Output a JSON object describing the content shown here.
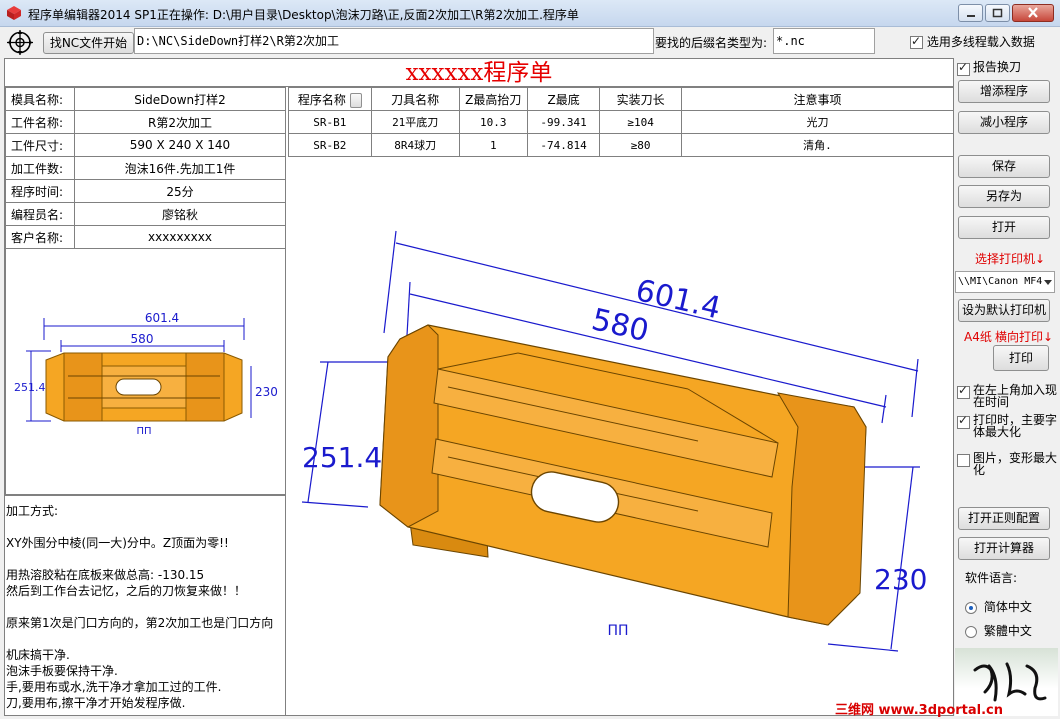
{
  "window": {
    "title": "程序单编辑器2014 SP1正在操作: D:\\用户目录\\Desktop\\泡沫刀路\\正,反面2次加工\\R第2次加工.程序单"
  },
  "toolbar": {
    "find_button": "找NC文件开始",
    "path_value": "D:\\NC\\SideDown打样2\\R第2次加工",
    "ext_label": "要找的后缀名类型为:",
    "ext_value": "*.nc",
    "multiline_label": "选用多线程载入数据",
    "multiline_checked": true
  },
  "sheet": {
    "title": "xxxxxx程序单",
    "info": [
      {
        "key": "模具名称:",
        "value": "SideDown打样2"
      },
      {
        "key": "工件名称:",
        "value": "R第2次加工"
      },
      {
        "key": "工件尺寸:",
        "value": "590 X 240 X 140"
      },
      {
        "key": "加工件数:",
        "value": "泡沫16件.先加工1件"
      },
      {
        "key": "程序时间:",
        "value": "25分"
      },
      {
        "key": "编程员名:",
        "value": "廖铭秋"
      },
      {
        "key": "客户名称:",
        "value": "xxxxxxxxx"
      }
    ],
    "program_headers": [
      "程序名称",
      "刀具名称",
      "Z最高抬刀",
      "Z最底",
      "实装刀长",
      "注意事项"
    ],
    "program_rows": [
      [
        "SR-B1",
        "21平底刀",
        "10.3",
        "-99.341",
        "≥104",
        "光刀"
      ],
      [
        "SR-B2",
        "8R4球刀",
        "1",
        "-74.814",
        "≥80",
        "清角."
      ]
    ],
    "notes": [
      "加工方式:",
      "XY外围分中棱(同一大)分中。Z顶面为零!!",
      "用热溶胶粘在底板来做总高: -130.15",
      "然后到工作台去记忆，之后的刀恢复来做！！",
      "原来第1次是门口方向的，第2次加工也是门口方向",
      "机床搞干净.",
      "泡沫手板要保持干净.",
      "手,要用布或水,洗干净才拿加工过的工件.",
      "刀,要用布,擦干净才开始发程序做."
    ],
    "thumb_dims": {
      "overall": "601.4",
      "inner": "580",
      "height": "251.4",
      "right": "230",
      "bottom": "ПП"
    },
    "drawing_dims": {
      "overall": "601.4",
      "inner": "580",
      "height": "251.4",
      "right": "230",
      "bottom": "ПП"
    }
  },
  "right_panel": {
    "report_wrap_label": "报告换刀",
    "report_wrap_checked": true,
    "add_program": "增添程序",
    "remove_program": "减小程序",
    "save": "保存",
    "save_as": "另存为",
    "open": "打开",
    "select_printer": "选择打印机↓",
    "printer_value": "\\\\MI\\Canon MF4",
    "set_default_printer": "设为默认打印机",
    "paper_a4": "A4纸",
    "landscape": "横向打印↓",
    "print": "打印",
    "add_time_label": "在左上角加入现在时间",
    "add_time_checked": true,
    "max_font_label": "打印时，主要字体最大化",
    "max_font_checked": true,
    "image_max_label": "图片，变形最大化",
    "image_max_checked": false,
    "open_regex_config": "打开正则配置",
    "open_calculator": "打开计算器",
    "language_label": "软件语言:",
    "lang_simplified": "简体中文",
    "lang_traditional": "繁體中文",
    "lang_selected": "简体中文"
  },
  "watermark": "三维网 www.3dportal.cn",
  "colors": {
    "part_orange": "#f5a623",
    "dim_blue": "#1a1acd",
    "title_red": "#e60000",
    "label_red": "#e00000"
  }
}
